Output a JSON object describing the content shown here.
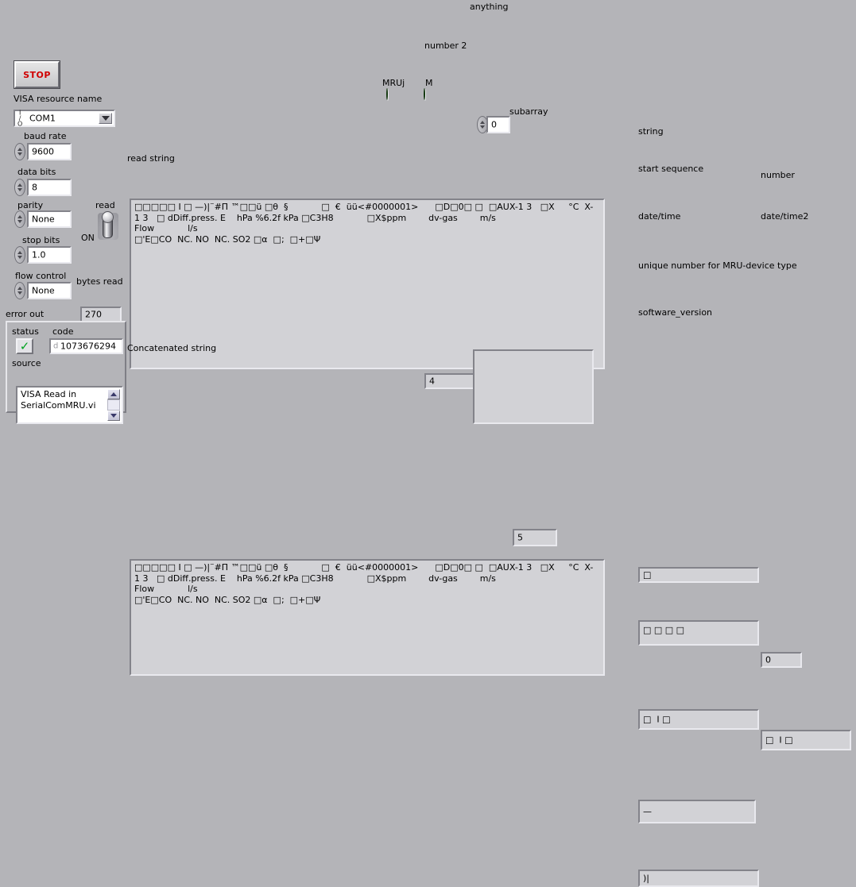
{
  "panel": {
    "background_color": "#b4b4b8",
    "field_color": "#d2d2d6",
    "control_color": "#ffffff",
    "accent_color": "#d00000",
    "led_color": "#2f6b25",
    "status_ok_color": "#00a21f"
  },
  "stop": {
    "label": "STOP"
  },
  "visa": {
    "label": "VISA resource name",
    "value": "COM1",
    "glyph": "I/O",
    "arrow_icon": "chevron-down-icon"
  },
  "serial": {
    "baud_rate": {
      "label": "baud rate",
      "value": "9600"
    },
    "data_bits": {
      "label": "data bits",
      "value": "8"
    },
    "parity": {
      "label": "parity",
      "value": "None"
    },
    "stop_bits": {
      "label": "stop bits",
      "value": "1.0"
    },
    "flow_control": {
      "label": "flow control",
      "value": "None"
    }
  },
  "read_switch": {
    "label": "read",
    "state_label": "ON"
  },
  "bytes_read": {
    "label": "bytes read",
    "value": "270"
  },
  "error_out": {
    "label": "error out",
    "status": {
      "label": "status",
      "icon": "checkmark-icon"
    },
    "code": {
      "label": "code",
      "value": "1073676294",
      "prefix": "d"
    },
    "source": {
      "label": "source",
      "value": "VISA Read in\nSerialComMRU.vi"
    }
  },
  "read_string": {
    "label": "read string",
    "value": "□□□□□ I □ —)|¨#Π ™□□ü □θ  §            □  €  üü<#0000001>      □D□0□ □  □AUX-1 3   □X     °C  X-\n1 3   □ dDiff.press. E    hPa %6.2f kPa □C3H8            □X$ppm        dv-gas        m/s\nFlow            l/s\n□'E□CO  NC. NO  NC. SO2 □α  □;  □+□Ψ"
  },
  "concatenated_string": {
    "label": "Concatenated string",
    "value": "□□□□□ I □ —)|¨#Π ™□□ü □θ  §            □  €  üü<#0000001>      □D□0□ □  □AUX-1 3   □X     °C  X-\n1 3   □ dDiff.press. E    hPa %6.2f kPa □C3H8            □X$ppm        dv-gas        m/s\nFlow            l/s\n□'E□CO  NC. NO  NC. SO2 □α  □;  □+□Ψ"
  },
  "leds": [
    {
      "label": "MRUj",
      "name": "mruj-led",
      "on": false
    },
    {
      "label": "M",
      "name": "m-led",
      "on": false
    }
  ],
  "number2": {
    "label": "number 2",
    "value": "4"
  },
  "anything": {
    "label": "anything",
    "value": ""
  },
  "index": {
    "value": "0"
  },
  "subarray": {
    "label": "subarray",
    "value": "5"
  },
  "right_column": {
    "string": {
      "label": "string",
      "value": "□"
    },
    "start_sequence": {
      "label": "start sequence",
      "value": "□ □ □ □"
    },
    "number": {
      "label": "number",
      "value": "0"
    },
    "date_time": {
      "label": "date/time",
      "value": "□  I □"
    },
    "date_time2": {
      "label": "date/time2",
      "value": "□  I □"
    },
    "unique_number": {
      "label": "unique number for MRU-device type",
      "value": "—"
    },
    "software_version": {
      "label": "software_version",
      "value": ")|"
    }
  }
}
